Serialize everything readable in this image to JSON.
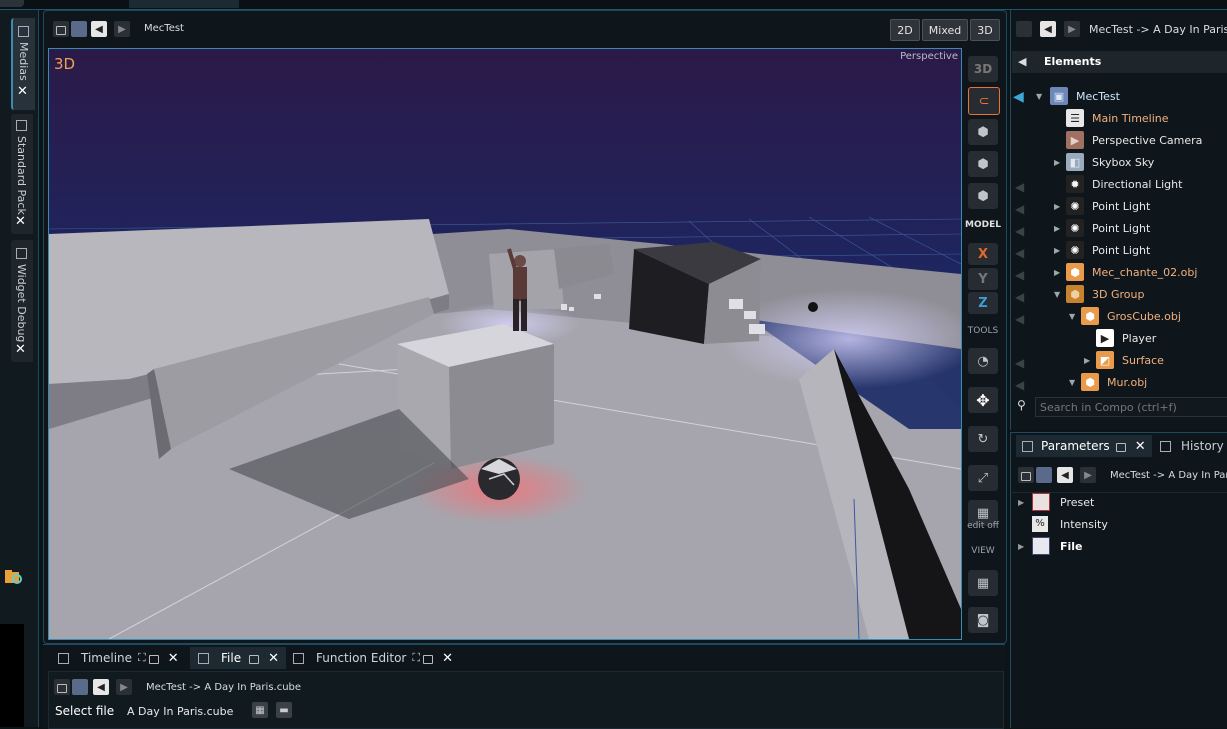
{
  "viewport": {
    "title": "MecTest",
    "mode_buttons": [
      "2D",
      "Mixed",
      "3D"
    ],
    "overlay_3d": "3D",
    "camera_label": "Perspective"
  },
  "tools": {
    "top_3d": "3D",
    "model_label": "MODEL",
    "x": "X",
    "y": "Y",
    "z": "Z",
    "tools_label": "TOOLS",
    "edit_off": "edit off",
    "view_label": "VIEW"
  },
  "left_tabs": [
    "Medias",
    "Standard Pack",
    "Widget Debug"
  ],
  "elements_panel": {
    "path": "MecTest -> A Day In Paris.c",
    "title": "Elements",
    "search_placeholder": "Search in Compo (ctrl+f)",
    "tree": [
      {
        "label": "MecTest",
        "icon": "composition-icon",
        "color": "#cfe6ff"
      },
      {
        "label": "Main Timeline",
        "icon": "timeline-icon",
        "color": "#f0b080"
      },
      {
        "label": "Perspective Camera",
        "icon": "camera-icon",
        "color": "#e8e8e8"
      },
      {
        "label": "Skybox Sky",
        "icon": "skybox-icon",
        "color": "#e8e8e8"
      },
      {
        "label": "Directional Light",
        "icon": "directional-light-icon",
        "color": "#e8e8e8"
      },
      {
        "label": "Point Light",
        "icon": "point-light-icon",
        "color": "#e8e8e8"
      },
      {
        "label": "Point Light",
        "icon": "point-light-icon",
        "color": "#e8e8e8"
      },
      {
        "label": "Point Light",
        "icon": "point-light-icon",
        "color": "#e8e8e8"
      },
      {
        "label": "Mec_chante_02.obj",
        "icon": "object-icon",
        "color": "#f0b080"
      },
      {
        "label": "3D Group",
        "icon": "group-icon",
        "color": "#f0b080"
      },
      {
        "label": "GrosCube.obj",
        "icon": "object-icon",
        "color": "#f0b080"
      },
      {
        "label": "Player",
        "icon": "player-icon",
        "color": "#e8e8e8"
      },
      {
        "label": "Surface",
        "icon": "surface-icon",
        "color": "#f0b080"
      },
      {
        "label": "Mur.obj",
        "icon": "object-icon",
        "color": "#f0b080"
      }
    ]
  },
  "parameters_panel": {
    "tab_parameters": "Parameters",
    "tab_history": "History",
    "path": "MecTest -> A Day In Paris",
    "rows": [
      {
        "label": "Preset",
        "bold": false
      },
      {
        "label": "Intensity",
        "bold": false
      },
      {
        "label": "File",
        "bold": true
      }
    ]
  },
  "bottom_panel": {
    "tabs": [
      "Timeline",
      "File",
      "Function Editor"
    ],
    "path": "MecTest -> A Day In Paris.cube",
    "select_label": "Select file",
    "file_value": "A Day In Paris.cube"
  }
}
